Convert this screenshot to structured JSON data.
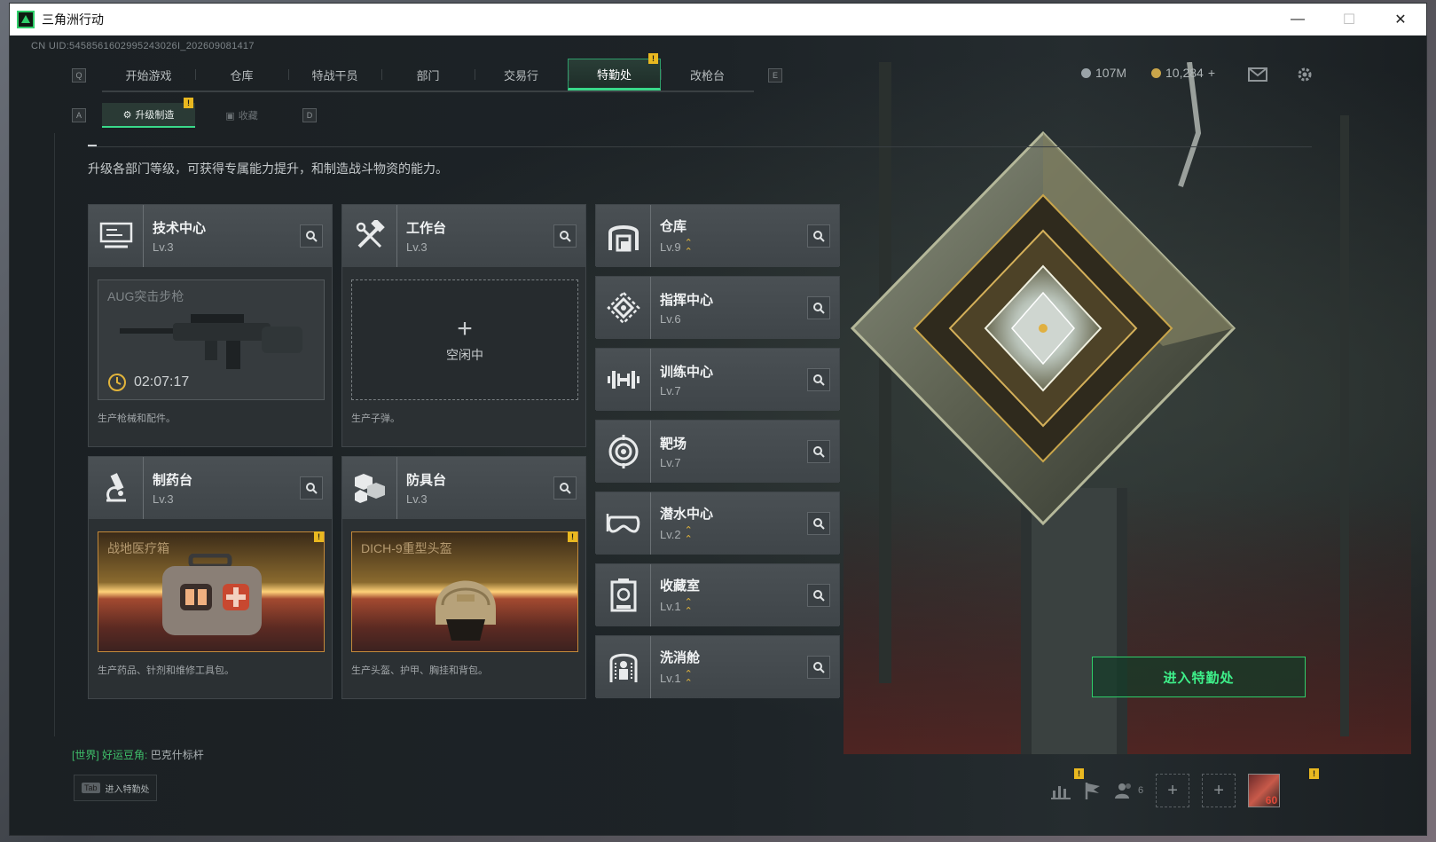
{
  "window": {
    "title": "三角洲行动",
    "controls": [
      "—",
      "☐",
      "✕"
    ]
  },
  "uid": "CN UID:5458561602995243026I_202609081417",
  "key_hints": {
    "tabs_left": "Q",
    "tabs_right": "E",
    "sub_left": "A",
    "sub_right": "D"
  },
  "nav": {
    "tabs": [
      {
        "label": "开始游戏",
        "active": false
      },
      {
        "label": "仓库",
        "active": false
      },
      {
        "label": "特战干员",
        "active": false
      },
      {
        "label": "部门",
        "active": false
      },
      {
        "label": "交易行",
        "active": false
      },
      {
        "label": "特勤处",
        "active": true
      },
      {
        "label": "改枪台",
        "active": false
      }
    ],
    "badge": "!"
  },
  "resources": {
    "currency1": "107M",
    "currency2": "10,284",
    "add": "+"
  },
  "subtabs": [
    {
      "label": "升级制造",
      "active": true
    },
    {
      "label": "收藏",
      "active": false
    }
  ],
  "description": "升级各部门等级，可获得专属能力提升，和制造战斗物资的能力。",
  "production": {
    "tech": {
      "name": "技术中心",
      "level": "Lv.3",
      "item": "AUG突击步枪",
      "timer": "02:07:17",
      "desc": "生产枪械和配件。"
    },
    "workbench": {
      "name": "工作台",
      "level": "Lv.3",
      "idle": "空闲中",
      "plus": "+",
      "desc": "生产子弹。"
    },
    "pharmacy": {
      "name": "制药台",
      "level": "Lv.3",
      "item": "战地医疗箱",
      "desc": "生产药品、针剂和维修工具包。",
      "badge": "!"
    },
    "armor": {
      "name": "防具台",
      "level": "Lv.3",
      "item": "DICH-9重型头盔",
      "desc": "生产头盔、护甲、胸挂和背包。",
      "badge": "!"
    }
  },
  "facilities": [
    {
      "name": "仓库",
      "level": "Lv.9",
      "upgrade": true,
      "icon": "warehouse-icon"
    },
    {
      "name": "指挥中心",
      "level": "Lv.6",
      "upgrade": false,
      "icon": "command-icon"
    },
    {
      "name": "训练中心",
      "level": "Lv.7",
      "upgrade": false,
      "icon": "dumbbell-icon"
    },
    {
      "name": "靶场",
      "level": "Lv.7",
      "upgrade": false,
      "icon": "target-icon"
    },
    {
      "name": "潜水中心",
      "level": "Lv.2",
      "upgrade": true,
      "icon": "diving-mask-icon"
    },
    {
      "name": "收藏室",
      "level": "Lv.1",
      "upgrade": true,
      "icon": "collection-icon"
    },
    {
      "name": "洗消舱",
      "level": "Lv.1",
      "upgrade": true,
      "icon": "decon-icon"
    }
  ],
  "enter_button": "进入特勤处",
  "chat": {
    "channel": "[世界]",
    "name": "好运豆角",
    "sep": ":",
    "message": "巴克什标杆"
  },
  "tab_hint": {
    "key": "Tab",
    "label": "进入特勤处"
  },
  "bottom": {
    "friends_count": "6",
    "plus": "+",
    "avatar_level": "60",
    "badge": "!"
  },
  "colors": {
    "accent": "#39d98a",
    "warning": "#e9b820",
    "upgrade": "#e2b43b"
  }
}
